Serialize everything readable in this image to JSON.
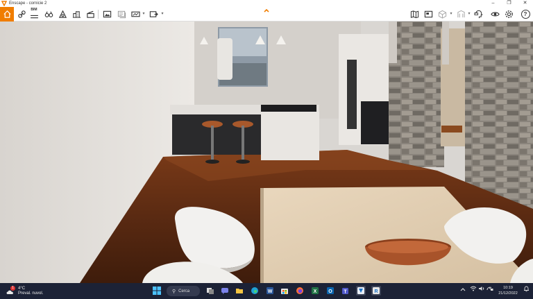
{
  "window": {
    "title": "Enscape - cornicie 2",
    "logo_icon": "enscape-logo-icon",
    "controls": [
      "minimize",
      "maximize",
      "close"
    ]
  },
  "toolbar": {
    "accent": "#f07d00",
    "left_tools": [
      {
        "name": "home-icon",
        "label": "Home",
        "active": true
      },
      {
        "name": "link-icon",
        "label": "Link"
      },
      {
        "name": "bim-icon",
        "label": "BIM"
      },
      {
        "name": "binoculars-icon",
        "label": "Views"
      },
      {
        "name": "asset-library-icon",
        "label": "Asset Library"
      },
      {
        "name": "buildings-icon",
        "label": "Buildings"
      },
      {
        "name": "clapperboard-icon",
        "label": "Video Editor"
      },
      {
        "name": "screenshot-icon",
        "label": "Render Image"
      },
      {
        "name": "batch-render-icon",
        "label": "Batch Render"
      },
      {
        "name": "panorama-icon",
        "label": "Panorama"
      },
      {
        "name": "export-icon",
        "label": "Export"
      }
    ],
    "right_tools": [
      {
        "name": "map-icon",
        "label": "Map"
      },
      {
        "name": "minimap-icon",
        "label": "Minimap"
      },
      {
        "name": "cube-icon",
        "label": "View Mode"
      },
      {
        "name": "section-icon",
        "label": "Section"
      },
      {
        "name": "user-head-icon",
        "label": "Collaboration"
      },
      {
        "name": "eye-icon",
        "label": "Visual Settings"
      },
      {
        "name": "gear-icon",
        "label": "General Settings"
      },
      {
        "name": "help-icon",
        "label": "?"
      }
    ],
    "bim_label": "BIM",
    "help_label": "?"
  },
  "taskbar": {
    "weather": {
      "temperature": "4°C",
      "condition": "Preval. nuvol.",
      "badge": "1"
    },
    "search_label": "Cerca",
    "apps": [
      "windows-start-icon",
      "search-icon",
      "task-view-icon",
      "teams-chat-icon",
      "file-explorer-icon",
      "edge-icon",
      "word-icon",
      "store-icon",
      "firefox-icon",
      "excel-icon",
      "outlook-icon",
      "teams-icon",
      "enscape-taskbar-icon",
      "revit-icon"
    ],
    "tray_chevron": "^",
    "clock": {
      "time": "10:19",
      "date": "21/12/2022"
    }
  }
}
